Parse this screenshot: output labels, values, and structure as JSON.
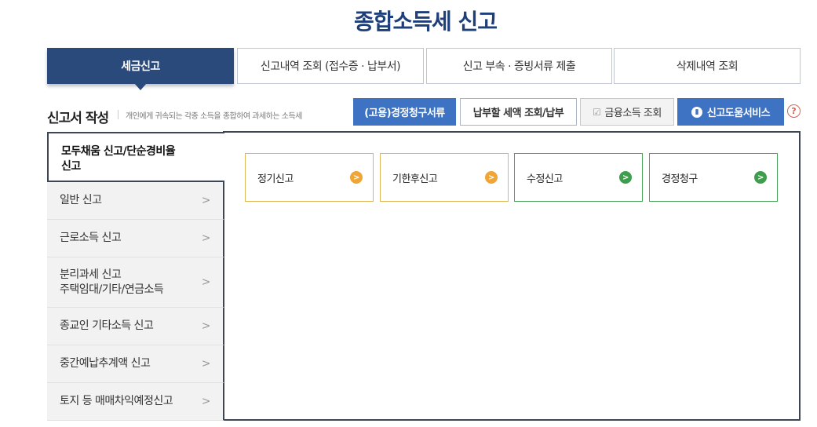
{
  "page": {
    "title": "종합소득세 신고"
  },
  "tabs": [
    {
      "label": "세금신고",
      "active": true
    },
    {
      "label": "신고내역 조회 (접수증 · 납부서)"
    },
    {
      "label": "신고 부속 · 증빙서류 제출"
    },
    {
      "label": "삭제내역 조회"
    }
  ],
  "section": {
    "title": "신고서 작성",
    "description": "개인에게 귀속되는 각종 소득을 종합하여 과세하는 소득세"
  },
  "header_buttons": [
    {
      "label": "(고용)경정청구서류",
      "style": "blue"
    },
    {
      "label": "납부할 세액 조회/납부",
      "style": "white"
    },
    {
      "label": "금융소득 조회",
      "style": "gray",
      "icon": "checkbox-icon"
    },
    {
      "label": "신고도움서비스",
      "style": "blue",
      "icon": "book-icon"
    }
  ],
  "help": {
    "glyph": "?"
  },
  "leftnav": [
    {
      "label": "모두채움 신고/단순경비율\n신고",
      "active": true
    },
    {
      "label": "일반 신고"
    },
    {
      "label": "근로소득 신고"
    },
    {
      "label": "분리과세 신고\n주택임대/기타/연금소득"
    },
    {
      "label": "종교인 기타소득 신고"
    },
    {
      "label": "중간예납추계액 신고"
    },
    {
      "label": "토지 등 매매차익예정신고"
    }
  ],
  "cards": [
    {
      "label": "정기신고",
      "color": "#f0a537"
    },
    {
      "label": "기한후신고",
      "color": "#f0a537"
    },
    {
      "label": "수정신고",
      "color": "#3e9e4e"
    },
    {
      "label": "경정청구",
      "color": "#3e9e4e"
    }
  ],
  "glyphs": {
    "nav_chevron": ">",
    "card_arrow": ">",
    "check": "☑"
  }
}
